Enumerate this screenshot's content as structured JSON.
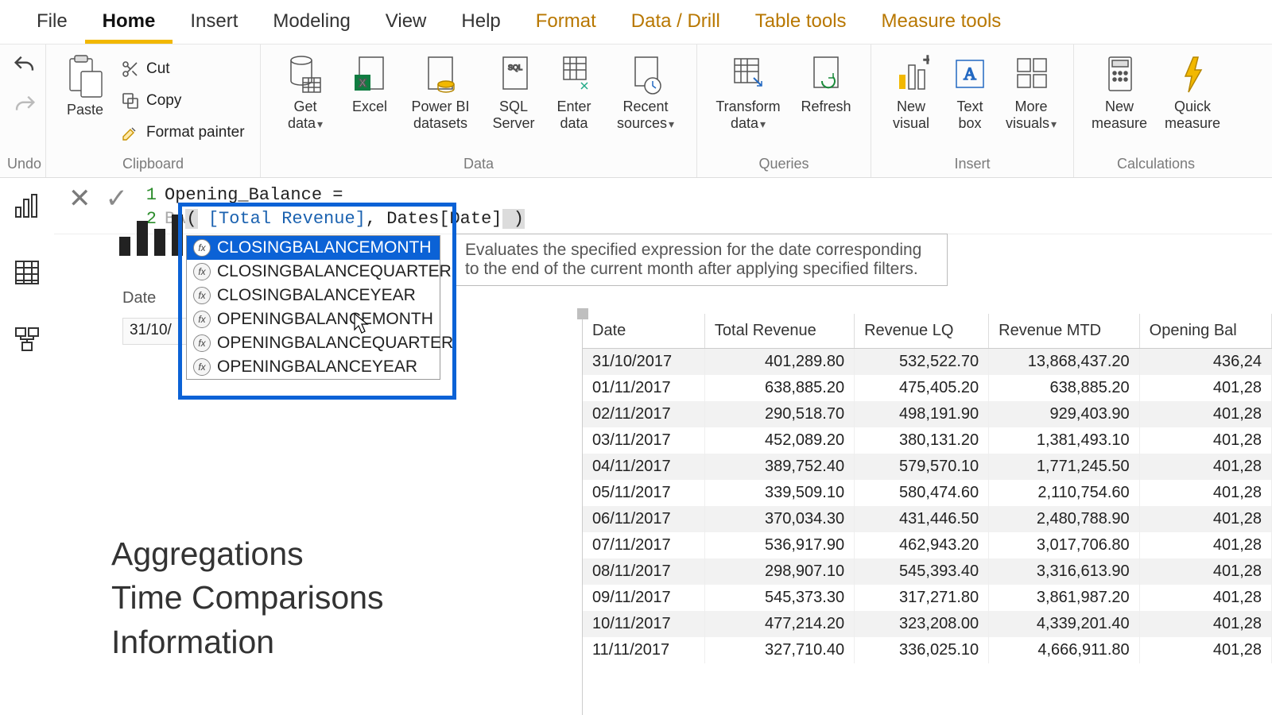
{
  "tabs": [
    "File",
    "Home",
    "Insert",
    "Modeling",
    "View",
    "Help",
    "Format",
    "Data / Drill",
    "Table tools",
    "Measure tools"
  ],
  "active_tab": "Home",
  "undo_label": "Undo",
  "clipboard": {
    "paste": "Paste",
    "cut": "Cut",
    "copy": "Copy",
    "format_painter": "Format painter",
    "group": "Clipboard"
  },
  "data_group": {
    "get_data": "Get\ndata",
    "excel": "Excel",
    "pbi_ds": "Power BI\ndatasets",
    "sql": "SQL\nServer",
    "enter": "Enter\ndata",
    "recent": "Recent\nsources",
    "group": "Data"
  },
  "queries_group": {
    "transform": "Transform\ndata",
    "refresh": "Refresh",
    "group": "Queries"
  },
  "insert_group": {
    "new_visual": "New\nvisual",
    "text_box": "Text\nbox",
    "more_visuals": "More\nvisuals",
    "group": "Insert"
  },
  "calc_group": {
    "new_measure": "New\nmeasure",
    "quick_measure": "Quick\nmeasure",
    "group": "Calculations"
  },
  "formula": {
    "line1": "Opening_Balance =",
    "line2_pre": "BA",
    "line2_expr_open": "(",
    "line2_col1": "[Total Revenue]",
    "line2_sep": ", ",
    "line2_col2": "Dates[Date]",
    "line2_close": " )",
    "ln1": "1",
    "ln2": "2"
  },
  "tooltip_text": "Evaluates the specified expression for the date corresponding to the end of the current month after applying specified filters.",
  "intelli": [
    "CLOSINGBALANCEMONTH",
    "CLOSINGBALANCEQUARTER",
    "CLOSINGBALANCEYEAR",
    "OPENINGBALANCEMONTH",
    "OPENINGBALANCEQUARTER",
    "OPENINGBALANCEYEAR"
  ],
  "date_header": "Date",
  "date_cell": "31/10/",
  "biglist": [
    "Aggregations",
    "Time Comparisons",
    "Information"
  ],
  "table": {
    "columns": [
      "Date",
      "Total Revenue",
      "Revenue LQ",
      "Revenue MTD",
      "Opening Bal"
    ],
    "rows": [
      [
        "31/10/2017",
        "401,289.80",
        "532,522.70",
        "13,868,437.20",
        "436,24"
      ],
      [
        "01/11/2017",
        "638,885.20",
        "475,405.20",
        "638,885.20",
        "401,28"
      ],
      [
        "02/11/2017",
        "290,518.70",
        "498,191.90",
        "929,403.90",
        "401,28"
      ],
      [
        "03/11/2017",
        "452,089.20",
        "380,131.20",
        "1,381,493.10",
        "401,28"
      ],
      [
        "04/11/2017",
        "389,752.40",
        "579,570.10",
        "1,771,245.50",
        "401,28"
      ],
      [
        "05/11/2017",
        "339,509.10",
        "580,474.60",
        "2,110,754.60",
        "401,28"
      ],
      [
        "06/11/2017",
        "370,034.30",
        "431,446.50",
        "2,480,788.90",
        "401,28"
      ],
      [
        "07/11/2017",
        "536,917.90",
        "462,943.20",
        "3,017,706.80",
        "401,28"
      ],
      [
        "08/11/2017",
        "298,907.10",
        "545,393.40",
        "3,316,613.90",
        "401,28"
      ],
      [
        "09/11/2017",
        "545,373.30",
        "317,271.80",
        "3,861,987.20",
        "401,28"
      ],
      [
        "10/11/2017",
        "477,214.20",
        "323,208.00",
        "4,339,201.40",
        "401,28"
      ],
      [
        "11/11/2017",
        "327,710.40",
        "336,025.10",
        "4,666,911.80",
        "401,28"
      ]
    ]
  }
}
